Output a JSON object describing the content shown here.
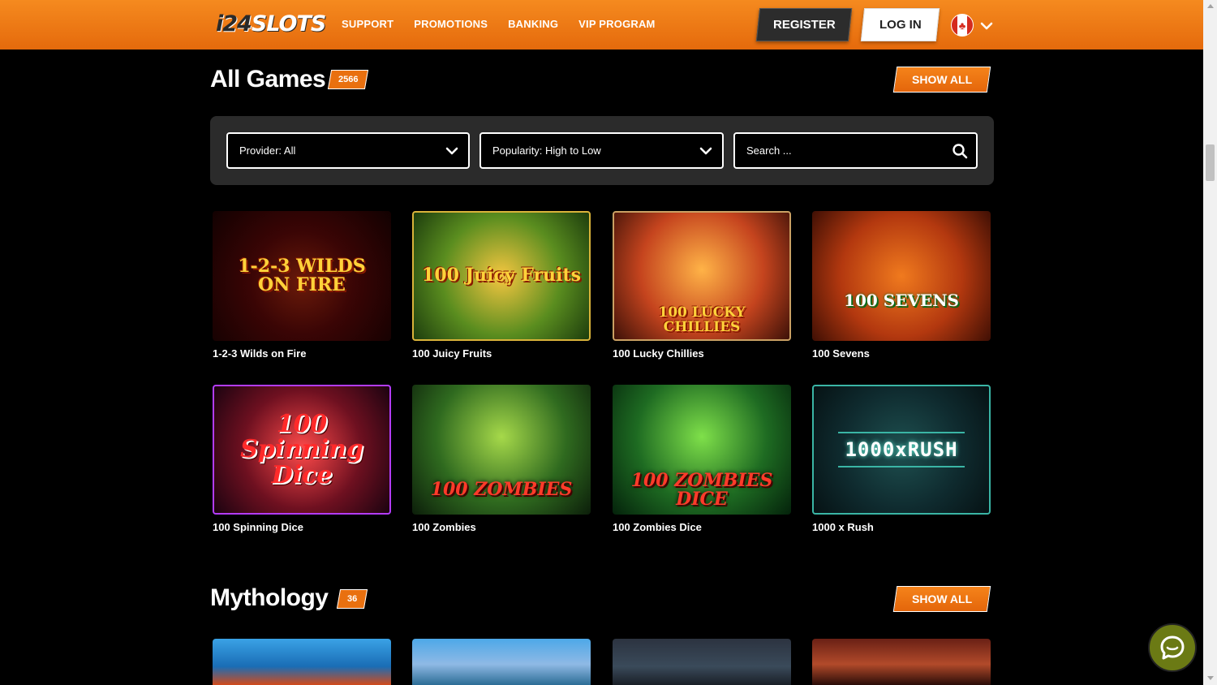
{
  "header": {
    "logo_main": "i24",
    "logo_slots": "SLOTS",
    "nav": [
      "SUPPORT",
      "PROMOTIONS",
      "BANKING",
      "VIP PROGRAM"
    ],
    "register_label": "REGISTER",
    "login_label": "LOG IN",
    "language_flag_icon": "canada-flag-icon"
  },
  "all_games": {
    "title": "All Games",
    "count": "2566",
    "show_all_label": "SHOW ALL",
    "filters": {
      "provider": "Provider: All",
      "sort": "Popularity: High to Low",
      "search_placeholder": "Search ..."
    },
    "games": [
      {
        "name": "1-2-3 Wilds on Fire",
        "art": "1-2-3 WILDS ON FIRE"
      },
      {
        "name": "100 Juicy Fruits",
        "art": "100 Juicy Fruits"
      },
      {
        "name": "100 Lucky Chillies",
        "art": "100 LUCKY CHILLIES"
      },
      {
        "name": "100 Sevens",
        "art": "100 SEVENS"
      },
      {
        "name": "100 Spinning Dice",
        "art": "100 Spinning Dice"
      },
      {
        "name": "100 Zombies",
        "art": "100 ZOMBIES"
      },
      {
        "name": "100 Zombies Dice",
        "art": "100 ZOMBIES DICE"
      },
      {
        "name": "1000 x Rush",
        "art": "1000xRUSH"
      }
    ]
  },
  "mythology": {
    "title": "Mythology",
    "count": "36",
    "show_all_label": "SHOW ALL"
  },
  "colors": {
    "brand_orange": "#e9700f",
    "header_gradient_top": "#f58a1f",
    "panel_gray": "#2b2b2b",
    "chat_green": "#6b7a14"
  },
  "chat_icon": "chat-bubble-icon"
}
